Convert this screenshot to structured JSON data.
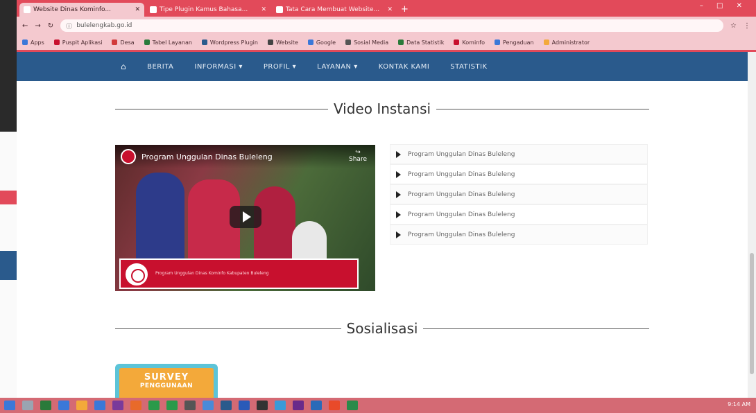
{
  "browser": {
    "tabs": [
      {
        "label": "Website Dinas Kominfo...",
        "active": true
      },
      {
        "label": "Tipe Plugin Kamus Bahasa...",
        "active": false
      },
      {
        "label": "Tata Cara Membuat Website...",
        "active": false
      }
    ],
    "url": "bulelengkab.go.id",
    "bookmarks": [
      "Apps",
      "Puspit Aplikasi",
      "Desa",
      "Tabel Layanan",
      "Wordpress Plugin",
      "Website",
      "Google",
      "Sosial Media",
      "Data Statistik",
      "Kominfo",
      "Pengaduan",
      "Administrator"
    ]
  },
  "navbar": {
    "items": [
      "BERITA",
      "INFORMASI ▾",
      "PROFIL ▾",
      "LAYANAN ▾",
      "KONTAK KAMI",
      "STATISTIK"
    ]
  },
  "sections": {
    "video_title": "Video Instansi",
    "social_title": "Sosialisasi"
  },
  "video": {
    "title": "Program Unggulan Dinas Buleleng",
    "share": "Share",
    "caption": "Program Unggulan Dinas Kominfo Kabupaten Buleleng"
  },
  "playlist": [
    "Program Unggulan Dinas Buleleng",
    "Program Unggulan Dinas Buleleng",
    "Program Unggulan Dinas Buleleng",
    "Program Unggulan Dinas Buleleng",
    "Program Unggulan Dinas Buleleng"
  ],
  "survey": {
    "line1": "SURVEY",
    "line2": "PENGGUNAAN"
  },
  "taskbar": {
    "clock": "9:14 AM"
  }
}
